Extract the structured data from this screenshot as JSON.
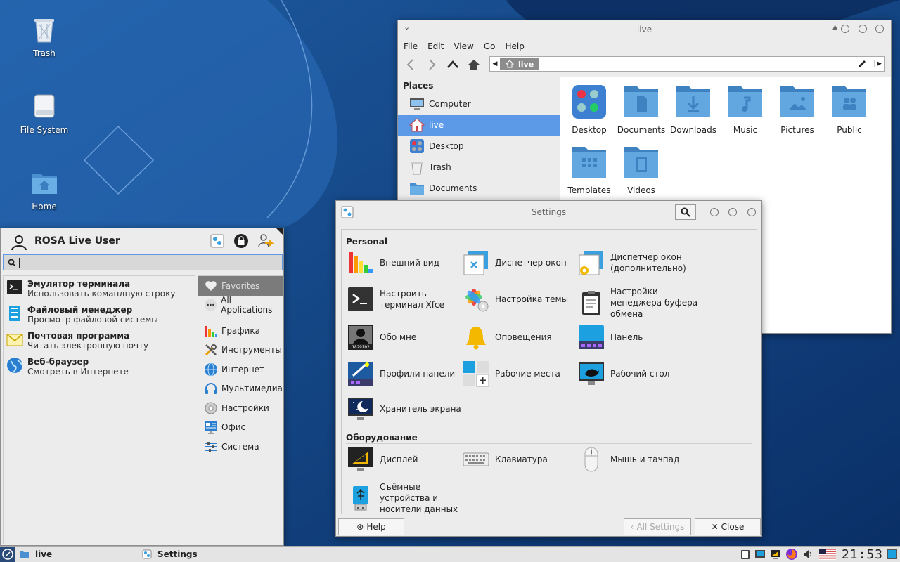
{
  "desktop": {
    "icons": [
      {
        "label": "Trash"
      },
      {
        "label": "File System"
      },
      {
        "label": "Home"
      }
    ]
  },
  "file_manager": {
    "title": "live",
    "menu": [
      "File",
      "Edit",
      "View",
      "Go",
      "Help"
    ],
    "path_crumb": "live",
    "places_header": "Places",
    "places": [
      "Computer",
      "live",
      "Desktop",
      "Trash",
      "Documents"
    ],
    "selected_place": "live",
    "items": [
      "Desktop",
      "Documents",
      "Downloads",
      "Music",
      "Pictures",
      "Public",
      "Templates",
      "Videos"
    ]
  },
  "settings": {
    "title": "Settings",
    "section_personal": "Personal",
    "personal": [
      {
        "label": "Внешний вид"
      },
      {
        "label": "Диспетчер окон"
      },
      {
        "label": "Диспетчер окон (дополнительно)"
      },
      {
        "label": "Настроить терминал Xfce"
      },
      {
        "label": "Настройка темы"
      },
      {
        "label": "Настройки менеджера буфера обмена"
      },
      {
        "label": "Обо мне"
      },
      {
        "label": "Оповещения"
      },
      {
        "label": "Панель"
      },
      {
        "label": "Профили панели"
      },
      {
        "label": "Рабочие места"
      },
      {
        "label": "Рабочий стол"
      },
      {
        "label": "Хранитель экрана"
      }
    ],
    "section_hardware": "Оборудование",
    "hardware": [
      {
        "label": "Дисплей"
      },
      {
        "label": "Клавиатура"
      },
      {
        "label": "Мышь и тачпад"
      },
      {
        "label": "Съёмные устройства и носители данных"
      }
    ],
    "help_label": "Help",
    "all_settings_label": "All Settings",
    "close_label": "Close",
    "about_me_badge": "1829102"
  },
  "menu": {
    "user": "ROSA Live User",
    "search_value": "",
    "favorites": [
      {
        "title": "Эмулятор терминала",
        "desc": "Использовать командную строку"
      },
      {
        "title": "Файловый менеджер",
        "desc": "Просмотр файловой системы"
      },
      {
        "title": "Почтовая программа",
        "desc": "Читать электронную почту"
      },
      {
        "title": "Веб-браузер",
        "desc": "Смотреть в Интернете"
      }
    ],
    "categories": [
      "Favorites",
      "All Applications",
      "Графика",
      "Инструменты",
      "Интернет",
      "Мультимедиа",
      "Настройки",
      "Офис",
      "Система"
    ]
  },
  "taskbar": {
    "task1": "live",
    "task2": "Settings",
    "clock": "21:53"
  },
  "colors": {
    "accent": "#5c9ae8",
    "folder": "#5a9fd6",
    "desktop_bg": "#0e3c78"
  }
}
